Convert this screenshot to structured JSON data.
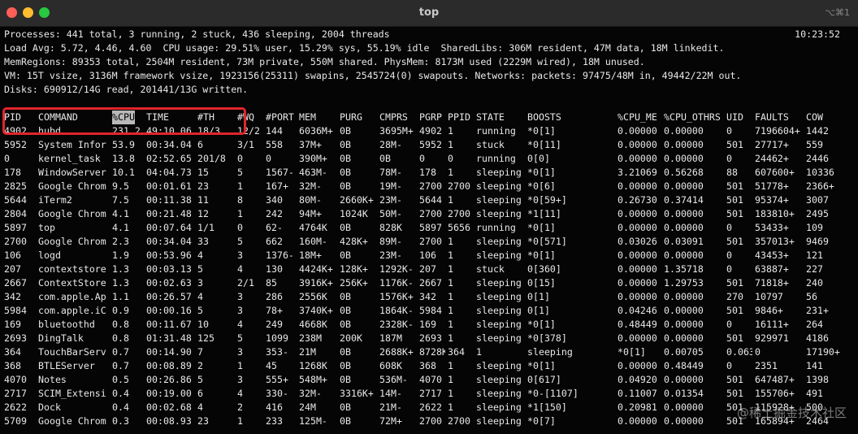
{
  "window": {
    "title": "top",
    "shortcut": "⌥⌘1"
  },
  "summary": {
    "processes": "Processes: 441 total, 3 running, 2 stuck, 436 sleeping, 2004 threads",
    "clock": "10:23:52",
    "load": "Load Avg: 5.72, 4.46, 4.60  CPU usage: 29.51% user, 15.29% sys, 55.19% idle  SharedLibs: 306M resident, 47M data, 18M linkedit.",
    "memregions": "MemRegions: 89353 total, 2504M resident, 73M private, 550M shared. PhysMem: 8173M used (2229M wired), 18M unused.",
    "vm": "VM: 15T vsize, 3136M framework vsize, 1923156(25311) swapins, 2545724(0) swapouts. Networks: packets: 97475/48M in, 49442/22M out.",
    "disks": "Disks: 690912/14G read, 201441/13G written."
  },
  "table": {
    "headers": [
      "PID",
      "COMMAND",
      "%CPU",
      "TIME",
      "#TH",
      "#WQ",
      "#PORT",
      "MEM",
      "PURG",
      "CMPRS",
      "PGRP",
      "PPID",
      "STATE",
      "BOOSTS",
      "%CPU_ME",
      "%CPU_OTHRS",
      "UID",
      "FAULTS",
      "COW"
    ],
    "rows": [
      [
        "4902",
        "hubd",
        "231.2",
        "49:10.06",
        "18/3",
        "12/2",
        "144",
        "6036M+",
        "0B",
        "3695M+",
        "4902",
        "1",
        "running",
        "*0[1]",
        "0.00000",
        "0.00000",
        "0",
        "7196604+",
        "1442"
      ],
      [
        "5952",
        "System Infor",
        "53.9",
        "00:34.04",
        "6",
        "3/1",
        "558",
        "37M+",
        "0B",
        "28M-",
        "5952",
        "1",
        "stuck",
        "*0[11]",
        "0.00000",
        "0.00000",
        "501",
        "27717+",
        "559"
      ],
      [
        "0",
        "kernel_task",
        "13.8",
        "02:52.65",
        "201/8",
        "0",
        "0",
        "390M+",
        "0B",
        "0B",
        "0",
        "0",
        "running",
        "0[0]",
        "0.00000",
        "0.00000",
        "0",
        "24462+",
        "2446"
      ],
      [
        "178",
        "WindowServer",
        "10.1",
        "04:04.73",
        "15",
        "5",
        "1567-",
        "463M-",
        "0B",
        "78M-",
        "178",
        "1",
        "sleeping",
        "*0[1]",
        "3.21069",
        "0.56268",
        "88",
        "607600+",
        "10336"
      ],
      [
        "2825",
        "Google Chrom",
        "9.5",
        "00:01.61",
        "23",
        "1",
        "167+",
        "32M-",
        "0B",
        "19M-",
        "2700",
        "2700",
        "sleeping",
        "*0[6]",
        "0.00000",
        "0.00000",
        "501",
        "51778+",
        "2366+"
      ],
      [
        "5644",
        "iTerm2",
        "7.5",
        "00:11.38",
        "11",
        "8",
        "340",
        "80M-",
        "2660K+",
        "23M-",
        "5644",
        "1",
        "sleeping",
        "*0[59+]",
        "0.26730",
        "0.37414",
        "501",
        "95374+",
        "3007"
      ],
      [
        "2804",
        "Google Chrom",
        "4.1",
        "00:21.48",
        "12",
        "1",
        "242",
        "94M+",
        "1024K",
        "50M-",
        "2700",
        "2700",
        "sleeping",
        "*1[11]",
        "0.00000",
        "0.00000",
        "501",
        "183810+",
        "2495"
      ],
      [
        "5897",
        "top",
        "4.1",
        "00:07.64",
        "1/1",
        "0",
        "62-",
        "4764K",
        "0B",
        "828K",
        "5897",
        "5656",
        "running",
        "*0[1]",
        "0.00000",
        "0.00000",
        "0",
        "53433+",
        "109"
      ],
      [
        "2700",
        "Google Chrom",
        "2.3",
        "00:34.04",
        "33",
        "5",
        "662",
        "160M-",
        "428K+",
        "89M-",
        "2700",
        "1",
        "sleeping",
        "*0[571]",
        "0.03026",
        "0.03091",
        "501",
        "357013+",
        "9469"
      ],
      [
        "106",
        "logd",
        "1.9",
        "00:53.96",
        "4",
        "3",
        "1376-",
        "18M+",
        "0B",
        "23M-",
        "106",
        "1",
        "sleeping",
        "*0[1]",
        "0.00000",
        "0.00000",
        "0",
        "43453+",
        "121"
      ],
      [
        "207",
        "contextstore",
        "1.3",
        "00:03.13",
        "5",
        "4",
        "130",
        "4424K+",
        "128K+",
        "1292K-",
        "207",
        "1",
        "stuck",
        "0[360]",
        "0.00000",
        "1.35718",
        "0",
        "63887+",
        "227"
      ],
      [
        "2667",
        "ContextStore",
        "1.3",
        "00:02.63",
        "3",
        "2/1",
        "85",
        "3916K+",
        "256K+",
        "1176K-",
        "2667",
        "1",
        "sleeping",
        "0[15]",
        "0.00000",
        "1.29753",
        "501",
        "71818+",
        "240"
      ],
      [
        "342",
        "com.apple.Ap",
        "1.1",
        "00:26.57",
        "4",
        "3",
        "286",
        "2556K",
        "0B",
        "1576K+",
        "342",
        "1",
        "sleeping",
        "0[1]",
        "0.00000",
        "0.00000",
        "270",
        "10797",
        "56"
      ],
      [
        "5984",
        "com.apple.iC",
        "0.9",
        "00:00.16",
        "5",
        "3",
        "78+",
        "3740K+",
        "0B",
        "1864K-",
        "5984",
        "1",
        "sleeping",
        "0[1]",
        "0.04246",
        "0.00000",
        "501",
        "9846+",
        "231+"
      ],
      [
        "169",
        "bluetoothd",
        "0.8",
        "00:11.67",
        "10",
        "4",
        "249",
        "4668K",
        "0B",
        "2328K-",
        "169",
        "1",
        "sleeping",
        "*0[1]",
        "0.48449",
        "0.00000",
        "0",
        "16111+",
        "264"
      ],
      [
        "2693",
        "DingTalk",
        "0.8",
        "01:31.48",
        "125",
        "5",
        "1099",
        "238M",
        "200K",
        "187M",
        "2693",
        "1",
        "sleeping",
        "*0[378]",
        "0.00000",
        "0.00000",
        "501",
        "929971",
        "4186"
      ],
      [
        "364",
        "TouchBarServ",
        "0.7",
        "00:14.90",
        "7",
        "3",
        "353-",
        "21M",
        "0B",
        "2688K+",
        "8728K-",
        "364",
        "1",
        "sleeping",
        "*0[1]",
        "0.00705",
        "0.06345",
        "0",
        "17190+"
      ],
      [
        "368",
        "BTLEServer",
        "0.7",
        "00:08.89",
        "2",
        "1",
        "45",
        "1268K",
        "0B",
        "608K",
        "368",
        "1",
        "sleeping",
        "*0[1]",
        "0.00000",
        "0.48449",
        "0",
        "2351",
        "141"
      ],
      [
        "4070",
        "Notes",
        "0.5",
        "00:26.86",
        "5",
        "3",
        "555+",
        "548M+",
        "0B",
        "536M-",
        "4070",
        "1",
        "sleeping",
        "0[617]",
        "0.04920",
        "0.00000",
        "501",
        "647487+",
        "1398"
      ],
      [
        "2717",
        "SCIM_Extensi",
        "0.4",
        "00:19.00",
        "6",
        "4",
        "330-",
        "32M-",
        "3316K+",
        "14M-",
        "2717",
        "1",
        "sleeping",
        "*0-[1107]",
        "0.11007",
        "0.01354",
        "501",
        "155706+",
        "491"
      ],
      [
        "2622",
        "Dock",
        "0.4",
        "00:02.68",
        "4",
        "2",
        "416",
        "24M",
        "0B",
        "21M-",
        "2622",
        "1",
        "sleeping",
        "*1[150]",
        "0.20981",
        "0.00000",
        "501",
        "115928+",
        "500"
      ],
      [
        "5709",
        "Google Chrom",
        "0.3",
        "00:08.93",
        "23",
        "1",
        "233",
        "125M-",
        "0B",
        "72M+",
        "2700",
        "2700",
        "sleeping",
        "*0[7]",
        "0.00000",
        "0.00000",
        "501",
        "165894+",
        "2464"
      ]
    ]
  },
  "watermark": "@稀土掘金技术社区"
}
